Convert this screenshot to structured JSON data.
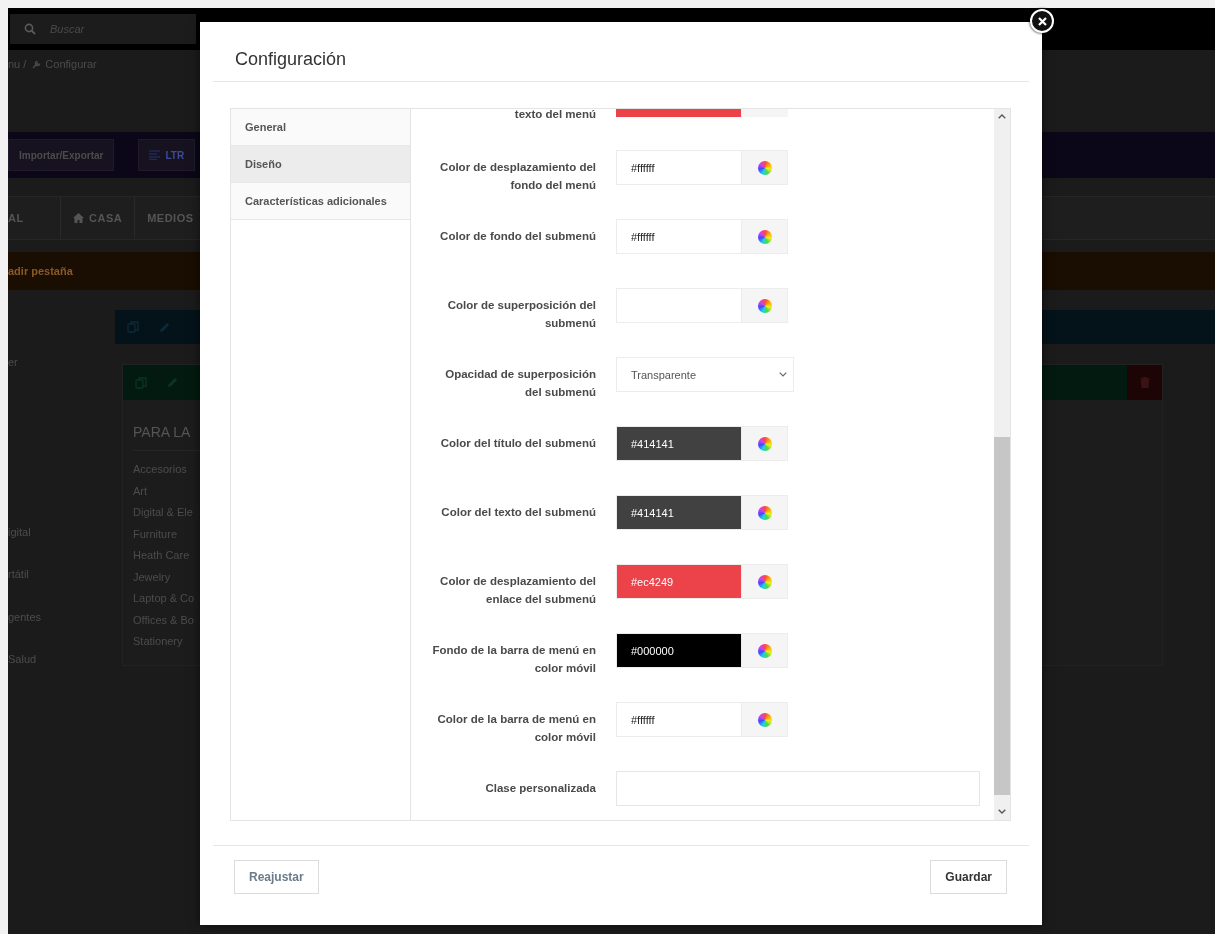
{
  "background": {
    "search": {
      "placeholder": "Buscar"
    },
    "breadcrumb": [
      {
        "label": "nu /",
        "has_icon": false
      },
      {
        "label": "Configurar",
        "has_icon": true
      }
    ],
    "toolbar_buttons": [
      {
        "label": "Importar/Exportar",
        "has_icon": false
      },
      {
        "label": "LTR",
        "has_icon": true
      }
    ],
    "tabs": [
      {
        "label": "AL",
        "has_icon": false
      },
      {
        "label": "CASA",
        "has_icon": true
      },
      {
        "label": "MEDIOS",
        "has_icon": false
      }
    ],
    "add_tab": "adir pestaña",
    "side_list": [
      "er",
      "igital",
      "rtátil",
      "gentes",
      "Salud"
    ],
    "card": {
      "title": "PARA LA",
      "items": [
        "Accesorios",
        "Art",
        "Digital & Ele",
        "Furniture",
        "Heath Care",
        "Jewelry",
        "Laptop & Co",
        "Offices & Bo",
        "Stationery"
      ]
    }
  },
  "dialog": {
    "title": "Configuración",
    "nav": [
      {
        "label": "General",
        "selected": false
      },
      {
        "label": "Diseño",
        "selected": true
      },
      {
        "label": "Características adicionales",
        "selected": false
      }
    ],
    "fields": [
      {
        "kind": "color",
        "label": "texto del menú",
        "clipped": true,
        "color": "#ec4249"
      },
      {
        "kind": "color",
        "label": "Color de desplazamiento del fondo del menú",
        "clipped": false,
        "value": "#ffffff",
        "color": "#ffffff"
      },
      {
        "kind": "color",
        "label": "Color de fondo del submenú",
        "clipped": false,
        "value": "#ffffff",
        "color": "#ffffff"
      },
      {
        "kind": "color",
        "label": "Color de superposición del submenú",
        "clipped": false
      },
      {
        "kind": "select",
        "label": "Opacidad de superposición del submenú",
        "clipped": false,
        "value": "Transparente"
      },
      {
        "kind": "color",
        "label": "Color del título del submenú",
        "clipped": false,
        "value": "#414141",
        "color": "#414141"
      },
      {
        "kind": "color",
        "label": "Color del texto del submenú",
        "clipped": false,
        "value": "#414141",
        "color": "#414141"
      },
      {
        "kind": "color",
        "label": "Color de desplazamiento del enlace del submenú",
        "clipped": false,
        "value": "#ec4249",
        "color": "#ec4249"
      },
      {
        "kind": "color",
        "label": "Fondo de la barra de menú en color móvil",
        "clipped": false,
        "value": "#000000",
        "color": "#000000"
      },
      {
        "kind": "color",
        "label": "Color de la barra de menú en color móvil",
        "clipped": false,
        "value": "#ffffff",
        "color": "#ffffff"
      },
      {
        "kind": "text",
        "label": "Clase personalizada",
        "clipped": false
      }
    ],
    "buttons": {
      "reset": "Reajustar",
      "save": "Guardar"
    }
  }
}
